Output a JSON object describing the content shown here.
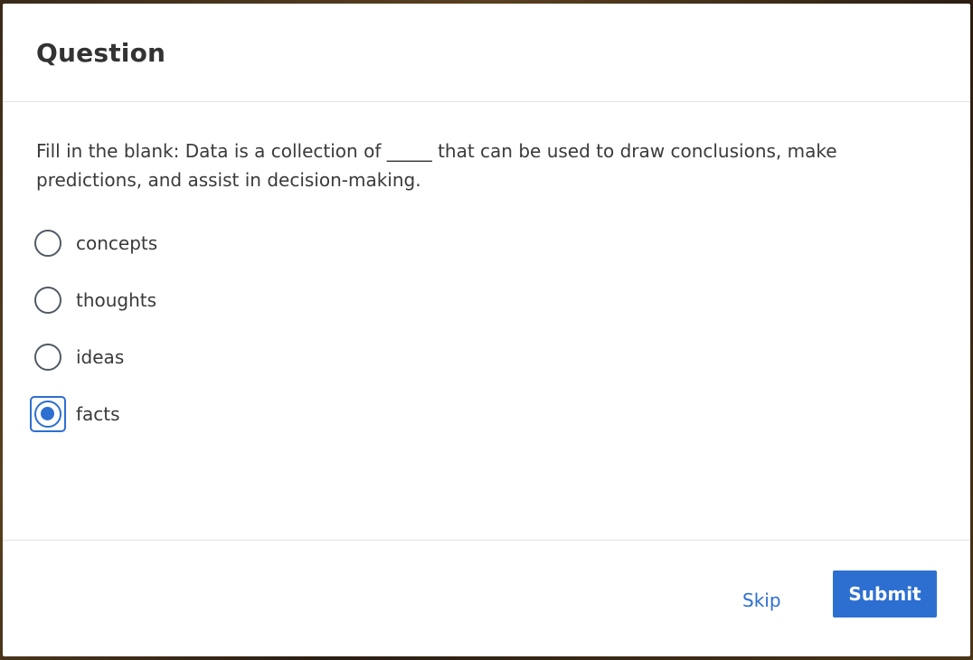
{
  "dialog": {
    "title": "Question",
    "prompt": "Fill in the blank: Data is a collection of _____ that can be used to draw conclusions, make predictions, and assist in decision-making.",
    "options": [
      {
        "label": "concepts",
        "selected": false
      },
      {
        "label": "thoughts",
        "selected": false
      },
      {
        "label": "ideas",
        "selected": false
      },
      {
        "label": "facts",
        "selected": true
      }
    ],
    "skip_label": "Skip",
    "submit_label": "Submit"
  },
  "colors": {
    "accent": "#2d6fd1",
    "text": "#3a3a3a",
    "title": "#333333"
  }
}
